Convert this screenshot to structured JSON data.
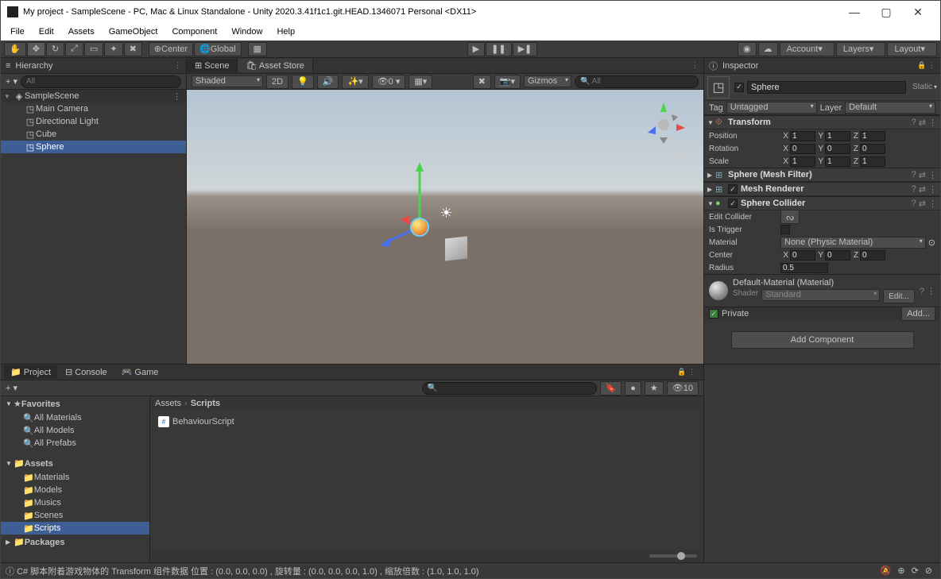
{
  "title": "My project - SampleScene - PC, Mac & Linux Standalone - Unity 2020.3.41f1c1.git.HEAD.1346071 Personal <DX11>",
  "menubar": [
    "File",
    "Edit",
    "Assets",
    "GameObject",
    "Component",
    "Window",
    "Help"
  ],
  "toolbar": {
    "center": "Center",
    "global": "Global",
    "account": "Account",
    "layers": "Layers",
    "layout": "Layout"
  },
  "hierarchy": {
    "title": "Hierarchy",
    "all_label": "All",
    "scene": "SampleScene",
    "items": [
      "Main Camera",
      "Directional Light",
      "Cube",
      "Sphere"
    ],
    "selected": "Sphere"
  },
  "scene_panel": {
    "tabs": [
      "Scene",
      "Asset Store"
    ],
    "shading": "Shaded",
    "mode_2d": "2D",
    "gizmos": "Gizmos",
    "persp": "Persp"
  },
  "project": {
    "tabs": [
      "Project",
      "Console",
      "Game"
    ],
    "favorites": "Favorites",
    "fav_items": [
      "All Materials",
      "All Models",
      "All Prefabs"
    ],
    "assets": "Assets",
    "asset_folders": [
      "Materials",
      "Models",
      "Musics",
      "Scenes",
      "Scripts"
    ],
    "packages": "Packages",
    "bc1": "Assets",
    "bc2": "Scripts",
    "file": "BehaviourScript",
    "count": "10"
  },
  "inspector": {
    "title": "Inspector",
    "name": "Sphere",
    "static": "Static",
    "tag_label": "Tag",
    "tag_value": "Untagged",
    "layer_label": "Layer",
    "layer_value": "Default",
    "transform": {
      "title": "Transform",
      "rows": [
        {
          "lbl": "Position",
          "x": "1",
          "y": "1",
          "z": "1"
        },
        {
          "lbl": "Rotation",
          "x": "0",
          "y": "0",
          "z": "0"
        },
        {
          "lbl": "Scale",
          "x": "1",
          "y": "1",
          "z": "1"
        }
      ]
    },
    "mesh_filter": "Sphere (Mesh Filter)",
    "mesh_renderer": "Mesh Renderer",
    "collider": {
      "title": "Sphere Collider",
      "edit": "Edit Collider",
      "trigger": "Is Trigger",
      "material_lbl": "Material",
      "material_val": "None (Physic Material)",
      "center_lbl": "Center",
      "center": {
        "x": "0",
        "y": "0",
        "z": "0"
      },
      "radius_lbl": "Radius",
      "radius": "0.5"
    },
    "material": {
      "title": "Default-Material (Material)",
      "shader_lbl": "Shader",
      "shader_val": "Standard",
      "edit": "Edit...",
      "private": "Private",
      "add": "Add..."
    },
    "add_component": "Add Component"
  },
  "status": "C# 脚本附着游戏物体的 Transform 组件数据 位置 : (0.0, 0.0, 0.0) , 旋转量 : (0.0, 0.0, 0.0, 1.0) , 缩放倍数 : (1.0, 1.0, 1.0)"
}
